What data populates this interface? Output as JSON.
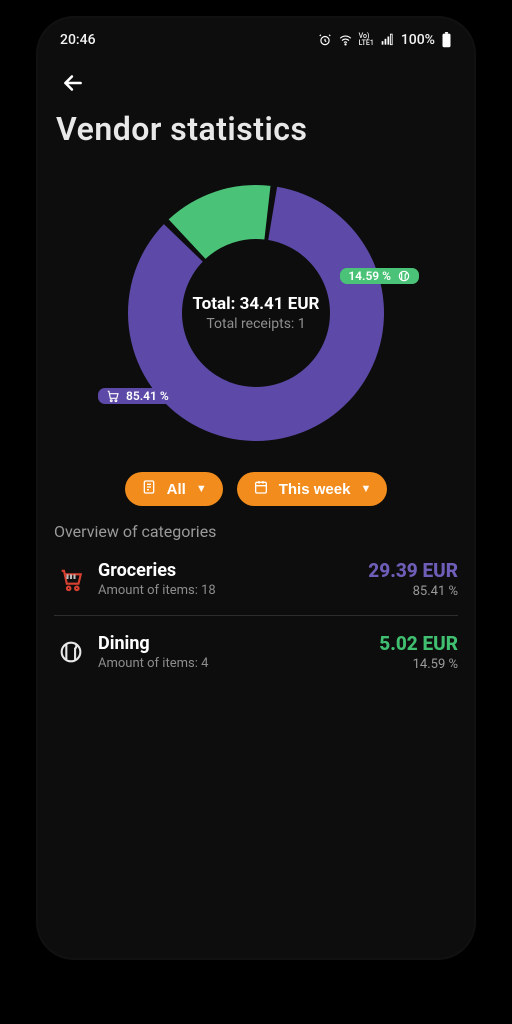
{
  "status": {
    "time": "20:46",
    "battery": "100%"
  },
  "header": {
    "title": "Vendor statistics"
  },
  "chart_data": {
    "type": "pie",
    "title": "",
    "total_label": "Total: 34.41 EUR",
    "receipts_label": "Total receipts: 1",
    "series": [
      {
        "name": "Groceries",
        "value": 29.39,
        "pct": 85.41,
        "color": "#5d4aa8",
        "icon": "cart"
      },
      {
        "name": "Dining",
        "value": 5.02,
        "pct": 14.59,
        "color": "#4ac378",
        "icon": "dining"
      }
    ],
    "badges": {
      "groceries_pct": "85.41 %",
      "dining_pct": "14.59 %"
    }
  },
  "filters": {
    "filter1_label": "All",
    "filter2_label": "This week"
  },
  "overview": {
    "section_title": "Overview of categories",
    "items": [
      {
        "name": "Groceries",
        "meta": "Amount of items: 18",
        "amount": "29.39 EUR",
        "pct": "85.41 %",
        "cls": "groc",
        "icon": "cart"
      },
      {
        "name": "Dining",
        "meta": "Amount of items: 4",
        "amount": "5.02 EUR",
        "pct": "14.59 %",
        "cls": "din",
        "icon": "dining"
      }
    ]
  }
}
